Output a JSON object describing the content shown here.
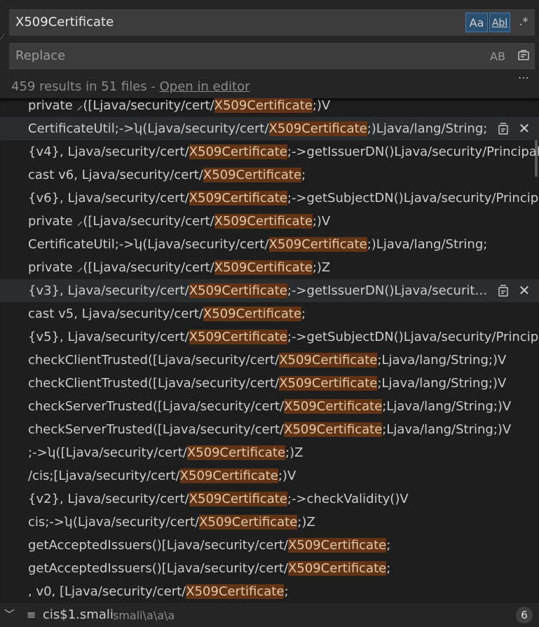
{
  "search": {
    "find_value": "X509Certificate",
    "match_case_label": "Aa",
    "whole_word_label": "Abl",
    "regex_label": ".*",
    "replace_placeholder": "Replace",
    "preserve_case_label": "AB"
  },
  "summary": {
    "text": "459 results in 51 files - ",
    "open_in_editor": "Open in editor"
  },
  "colors": {
    "match_highlight": "#623315",
    "active_option": "#2b4f6e"
  },
  "results": [
    {
      "pre": "private ⸝([Ljava/security/cert/",
      "match": "X509Certificate",
      "post": ";)V"
    },
    {
      "pre": "CertificateUtil;->ʮ(Ljava/security/cert/",
      "match": "X509Certificate",
      "post": ";)Ljava/lang/String;",
      "hover": true
    },
    {
      "pre": "{v4}, Ljava/security/cert/",
      "match": "X509Certificate",
      "post": ";->getIssuerDN()Ljava/security/Principal;"
    },
    {
      "pre": "cast v6, Ljava/security/cert/",
      "match": "X509Certificate",
      "post": ";"
    },
    {
      "pre": "{v6}, Ljava/security/cert/",
      "match": "X509Certificate",
      "post": ";->getSubjectDN()Ljava/security/Principal;"
    },
    {
      "pre": "private ⸝([Ljava/security/cert/",
      "match": "X509Certificate",
      "post": ";)V"
    },
    {
      "pre": "CertificateUtil;->ʮ(Ljava/security/cert/",
      "match": "X509Certificate",
      "post": ";)Ljava/lang/String;"
    },
    {
      "pre": "private ⸝([Ljava/security/cert/",
      "match": "X509Certificate",
      "post": ";)Z"
    },
    {
      "pre": "{v3}, Ljava/security/cert/",
      "match": "X509Certificate",
      "post": ";->getIssuerDN()Ljava/security/Prin...",
      "hover": true
    },
    {
      "pre": "cast v5, Ljava/security/cert/",
      "match": "X509Certificate",
      "post": ";"
    },
    {
      "pre": "{v5}, Ljava/security/cert/",
      "match": "X509Certificate",
      "post": ";->getSubjectDN()Ljava/security/Principal;"
    },
    {
      "pre": "checkClientTrusted([Ljava/security/cert/",
      "match": "X509Certificate",
      "post": ";Ljava/lang/String;)V"
    },
    {
      "pre": "checkClientTrusted([Ljava/security/cert/",
      "match": "X509Certificate",
      "post": ";Ljava/lang/String;)V"
    },
    {
      "pre": "checkServerTrusted([Ljava/security/cert/",
      "match": "X509Certificate",
      "post": ";Ljava/lang/String;)V"
    },
    {
      "pre": "checkServerTrusted([Ljava/security/cert/",
      "match": "X509Certificate",
      "post": ";Ljava/lang/String;)V"
    },
    {
      "pre": ";->ʮ([Ljava/security/cert/",
      "match": "X509Certificate",
      "post": ";)Z"
    },
    {
      "pre": "/cis;[Ljava/security/cert/",
      "match": "X509Certificate",
      "post": ";)V"
    },
    {
      "pre": "{v2}, Ljava/security/cert/",
      "match": "X509Certificate",
      "post": ";->checkValidity()V"
    },
    {
      "pre": "cis;->ʮ(Ljava/security/cert/",
      "match": "X509Certificate",
      "post": ";)Z"
    },
    {
      "pre": "getAcceptedIssuers()[Ljava/security/cert/",
      "match": "X509Certificate",
      "post": ";"
    },
    {
      "pre": "getAcceptedIssuers()[Ljava/security/cert/",
      "match": "X509Certificate",
      "post": ";"
    },
    {
      "pre": ", v0, [Ljava/security/cert/",
      "match": "X509Certificate",
      "post": ";"
    }
  ],
  "file": {
    "name": "cis$1.smali",
    "path": "smali\\a\\a\\a",
    "count": "6",
    "icon": "lines-file-icon"
  }
}
